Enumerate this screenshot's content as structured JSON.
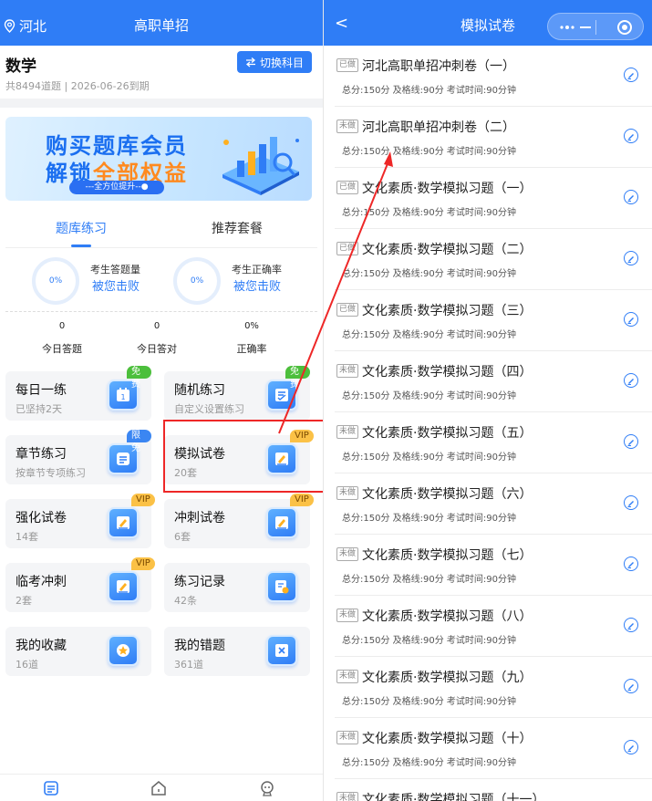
{
  "left": {
    "header": {
      "location": "河北",
      "title": "高职单招"
    },
    "subject": {
      "name": "数学",
      "meta": "共8494道题 | 2026-06-26到期",
      "switch_label": "切换科目"
    },
    "banner": {
      "line1": "购买题库会员",
      "line2_pre": "解锁",
      "line2_accent": "全部权益",
      "pill": "---全方位提升--●"
    },
    "tabs": [
      "题库练习",
      "推荐套餐"
    ],
    "stats": [
      {
        "percent": "0%",
        "label": "考生答题量",
        "value": "被您击败"
      },
      {
        "percent": "0%",
        "label": "考生正确率",
        "value": "被您击败"
      }
    ],
    "today": [
      {
        "num": "0",
        "label": "今日答题"
      },
      {
        "num": "0",
        "label": "今日答对"
      },
      {
        "num": "0%",
        "label": "正确率"
      }
    ],
    "cards": [
      {
        "title": "每日一练",
        "sub": "已坚持2天",
        "badge": "免费",
        "badge_type": "green",
        "icon": "calendar-icon"
      },
      {
        "title": "随机练习",
        "sub": "自定义设置练习",
        "badge": "免费",
        "badge_type": "green",
        "icon": "random-icon"
      },
      {
        "title": "章节练习",
        "sub": "按章节专项练习",
        "badge": "限免",
        "badge_type": "blue",
        "icon": "chapter-icon"
      },
      {
        "title": "模拟试卷",
        "sub": "20套",
        "badge": "VIP",
        "badge_type": "vip",
        "icon": "paper-pen-icon"
      },
      {
        "title": "强化试卷",
        "sub": "14套",
        "badge": "VIP",
        "badge_type": "vip",
        "icon": "paper-pen-icon"
      },
      {
        "title": "冲刺试卷",
        "sub": "6套",
        "badge": "VIP",
        "badge_type": "vip",
        "icon": "paper-pen-icon"
      },
      {
        "title": "临考冲刺",
        "sub": "2套",
        "badge": "VIP",
        "badge_type": "vip",
        "icon": "paper-pen-icon"
      },
      {
        "title": "练习记录",
        "sub": "42条",
        "badge": "",
        "badge_type": "",
        "icon": "record-icon"
      },
      {
        "title": "我的收藏",
        "sub": "16道",
        "badge": "",
        "badge_type": "",
        "icon": "star-icon"
      },
      {
        "title": "我的错题",
        "sub": "361道",
        "badge": "",
        "badge_type": "",
        "icon": "wrong-icon"
      }
    ]
  },
  "right": {
    "header": {
      "title": "模拟试卷",
      "back": "<"
    },
    "meta": "总分:150分  及格线:90分  考试时间:90分钟",
    "papers": [
      {
        "tag": "已做",
        "name": "河北高职单招冲刺卷（一）"
      },
      {
        "tag": "未做",
        "name": "河北高职单招冲刺卷（二）"
      },
      {
        "tag": "已做",
        "name": "文化素质·数学模拟习题（一）"
      },
      {
        "tag": "已做",
        "name": "文化素质·数学模拟习题（二）"
      },
      {
        "tag": "已做",
        "name": "文化素质·数学模拟习题（三）"
      },
      {
        "tag": "未做",
        "name": "文化素质·数学模拟习题（四）"
      },
      {
        "tag": "未做",
        "name": "文化素质·数学模拟习题（五）"
      },
      {
        "tag": "未做",
        "name": "文化素质·数学模拟习题（六）"
      },
      {
        "tag": "未做",
        "name": "文化素质·数学模拟习题（七）"
      },
      {
        "tag": "未做",
        "name": "文化素质·数学模拟习题（八）"
      },
      {
        "tag": "未做",
        "name": "文化素质·数学模拟习题（九）"
      },
      {
        "tag": "未做",
        "name": "文化素质·数学模拟习题（十）"
      },
      {
        "tag": "未做",
        "name": "文化素质·数学模拟习题（十一）"
      }
    ]
  },
  "colors": {
    "primary": "#2f7df6",
    "annotation": "#ee2727",
    "vip": "#fbc146",
    "free": "#4cbf3c"
  }
}
